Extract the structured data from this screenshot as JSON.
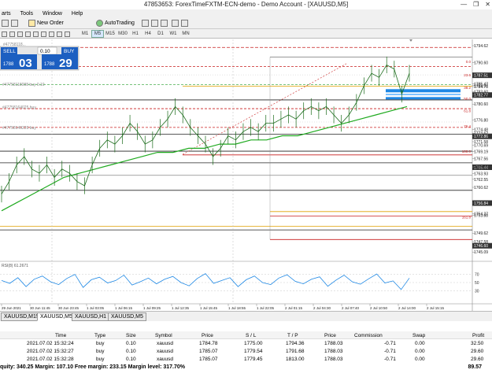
{
  "window": {
    "title": "47853653: ForexTimeFXTM-ECN-demo - Demo Account - [XAUUSD,M5]",
    "buttons": [
      "—",
      "❐",
      "✕"
    ]
  },
  "menu": [
    "arts",
    "Tools",
    "Window",
    "Help"
  ],
  "toolbar": {
    "new_order_label": "New Order",
    "auto_trading_label": "AutoTrading",
    "timeframes": [
      "M1",
      "M5",
      "M15",
      "M30",
      "H1",
      "H4",
      "D1",
      "W1",
      "MN"
    ],
    "active_timeframe": "M5"
  },
  "trade_panel": {
    "sell_label": "SELL",
    "sell_price_small": "1788",
    "sell_price_big": "03",
    "lot_value": "0.10",
    "buy_label": "BUY",
    "buy_price_small": "1788",
    "buy_price_big": "29"
  },
  "chart_data": {
    "type": "line",
    "symbol": "XAUUSD",
    "timeframe": "M5",
    "price_axis": [
      "1794.62",
      "1790.60",
      "1787.51",
      "1785.47",
      "1785.07",
      "1784.78",
      "1783.60",
      "1782.77",
      "1780.60",
      "1776.80",
      "1774.48",
      "1773.62",
      "1772.86",
      "1771.58",
      "1770.69",
      "1769.19",
      "1767.56",
      "1765.44",
      "1765.55",
      "1763.93",
      "1762.55",
      "1760.62",
      "1756.84",
      "1754.27",
      "1753.88",
      "1749.62",
      "1747.58",
      "1746.60",
      "1745.09"
    ],
    "time_axis": [
      "29 Jun 2021",
      "30 Jun 11:45",
      "30 Jun 23:45",
      "1 Jul 03:05",
      "1 Jul 06:15",
      "1 Jul 09:25",
      "1 Jul 12:35",
      "1 Jul 15:45",
      "1 Jul 18:55",
      "1 Jul 22:05",
      "2 Jul 01:15",
      "2 Jul 04:30",
      "2 Jul 07:40",
      "2 Jul 10:50",
      "2 Jul 14:00",
      "2 Jul 15:15"
    ],
    "fib_labels": [
      "0.0",
      "23.6",
      "38.2",
      "50.0",
      "61.8",
      "76.4",
      "100.0",
      "161.8"
    ],
    "order_lines": [
      "#47758118088 buy 0.10",
      "#47758164025 buy",
      "#47758149220 buy"
    ],
    "close_series": [
      1759,
      1762,
      1766,
      1768,
      1765,
      1764,
      1766,
      1763,
      1765,
      1764,
      1762,
      1761,
      1766,
      1770,
      1772,
      1771,
      1773,
      1776,
      1774,
      1771,
      1772,
      1775,
      1777,
      1780,
      1778,
      1775,
      1773,
      1771,
      1768,
      1770,
      1773,
      1772,
      1774,
      1775,
      1774,
      1776,
      1776,
      1777,
      1778,
      1777,
      1779,
      1780,
      1779,
      1780,
      1778,
      1776,
      1778,
      1781,
      1785,
      1788,
      1787,
      1790,
      1789,
      1783,
      1788
    ],
    "ma_series": [
      1755,
      1757,
      1759,
      1761,
      1763,
      1764,
      1765,
      1766,
      1767,
      1768,
      1769,
      1769,
      1770,
      1770,
      1771,
      1771,
      1772,
      1772,
      1773,
      1773,
      1774,
      1775,
      1776,
      1777,
      1778,
      1779,
      1780
    ],
    "indicator": {
      "name": "RSI(8) 61.2671",
      "levels": [
        "70",
        "50",
        "30"
      ],
      "values": [
        55,
        48,
        62,
        40,
        58,
        66,
        52,
        45,
        60,
        70,
        38,
        57,
        63,
        49,
        55,
        68,
        44,
        52,
        61,
        47,
        58,
        65,
        50,
        42,
        60,
        72,
        48,
        55,
        62,
        40,
        57,
        66,
        50,
        45,
        61,
        69,
        53,
        47,
        58,
        64,
        41,
        56,
        68,
        52,
        46,
        59,
        71,
        49,
        54,
        33,
        61
      ]
    }
  },
  "chart_tabs": [
    "XAUUSD,M15",
    "XAUUSD,M5",
    "XAUUSD,H1",
    "XAUUSD,M5"
  ],
  "active_chart_tab": 1,
  "trades": {
    "columns": [
      "Time",
      "Type",
      "Size",
      "Symbol",
      "Price",
      "S / L",
      "T / P",
      "Price",
      "Commission",
      "Swap",
      "Profit"
    ],
    "rows": [
      [
        "2021.07.02 15:32:24",
        "buy",
        "0.10",
        "xauusd",
        "1784.78",
        "1775.00",
        "1794.36",
        "1788.03",
        "-0.71",
        "0.00",
        "32.50"
      ],
      [
        "2021.07.02 15:32:27",
        "buy",
        "0.10",
        "xauusd",
        "1785.07",
        "1779.54",
        "1791.68",
        "1788.03",
        "-0.71",
        "0.00",
        "29.60"
      ],
      [
        "2021.07.02 15:32:28",
        "buy",
        "0.10",
        "xauusd",
        "1785.07",
        "1779.45",
        "1813.00",
        "1788.03",
        "-0.71",
        "0.00",
        "29.60"
      ]
    ],
    "balance_text": "quity: 340.25  Margin: 107.10  Free margin: 233.15  Margin level: 317.70%",
    "total_profit": "89.57"
  }
}
